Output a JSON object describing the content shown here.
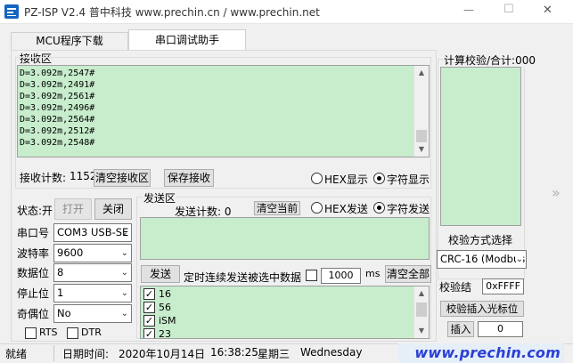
{
  "window": {
    "title": "PZ-ISP V2.4 普中科技 www.prechin.cn / www.prechin.net",
    "minimize_glyph": "—",
    "maximize_glyph": "☐",
    "close_glyph": "✕"
  },
  "tabs": [
    {
      "label": "MCU程序下载",
      "active": false
    },
    {
      "label": "串口调试助手",
      "active": true
    }
  ],
  "receive": {
    "group_label": "接收区",
    "lines": [
      "D=3.092m,2547#",
      "D=3.092m,2491#",
      "D=3.092m,2561#",
      "D=3.092m,2496#",
      "D=3.092m,2564#",
      "D=3.092m,2512#",
      "D=3.092m,2548#"
    ],
    "count_label": "接收计数:",
    "count_value": "1152",
    "clear_button": "清空接收区",
    "save_button": "保存接收",
    "hex_label": "HEX显示",
    "char_label": "字符显示",
    "mode": "char"
  },
  "checksum": {
    "group_label": "计算校验/合计:000",
    "method_label": "校验方式选择",
    "method_value": "CRC-16 (Modbus",
    "result_label": "校验结",
    "result_value": "0xFFFF",
    "insert_cursor_button": "校验插入光标位",
    "insert_button": "插入",
    "insert_value": "0",
    "side_arrow": "»"
  },
  "settings": {
    "status_label": "状态:开",
    "open_button": "打开",
    "close_button": "关闭",
    "port_label": "串口号",
    "port_value": "COM3  USB-SE",
    "baud_label": "波特率",
    "baud_value": "9600",
    "databits_label": "数据位",
    "databits_value": "8",
    "stopbits_label": "停止位",
    "stopbits_value": "1",
    "parity_label": "奇偶位",
    "parity_value": "No",
    "rts_label": "RTS",
    "dtr_label": "DTR"
  },
  "send": {
    "group_label": "发送区",
    "count_label": "发送计数: 0",
    "clear_current_button": "清空当前",
    "hex_label": "HEX发送",
    "char_label": "字符发送",
    "mode": "char",
    "send_button": "发送",
    "timed_label": "定时连续发送被选中数据",
    "interval_value": "1000",
    "interval_unit": "ms",
    "clear_all_button": "清空全部",
    "items": [
      {
        "text": "16",
        "checked": true
      },
      {
        "text": "56",
        "checked": true
      },
      {
        "text": "iSM",
        "checked": true
      },
      {
        "text": "23",
        "checked": true
      }
    ]
  },
  "statusbar": {
    "state": "就绪",
    "date_label": "日期时间:",
    "date": "2020年10月14日",
    "time": "16:38:25",
    "weekday_cn": "星期三",
    "weekday_en": "Wednesday",
    "site": "www.prechin.com"
  }
}
